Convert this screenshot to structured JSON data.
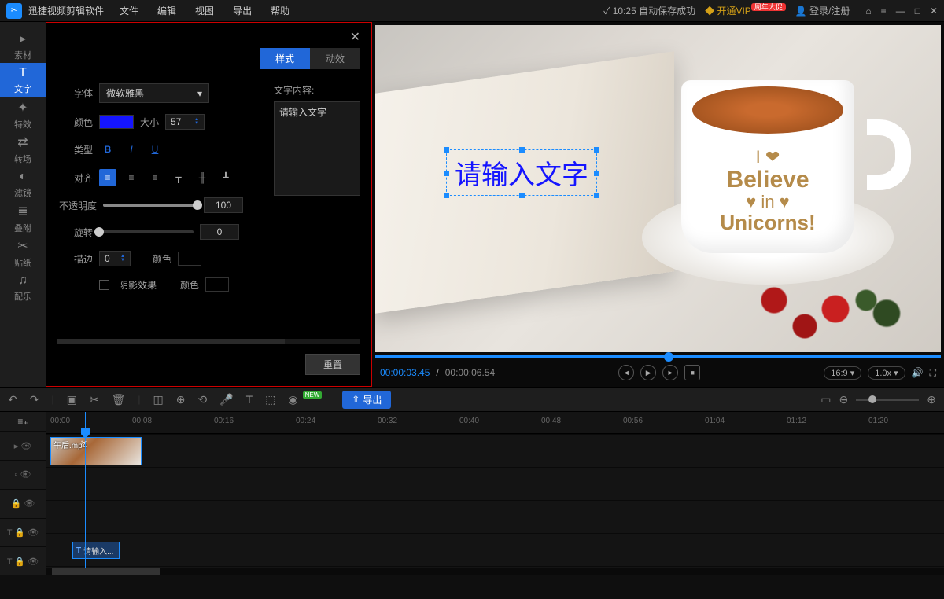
{
  "app": {
    "name": "迅捷视频剪辑软件"
  },
  "menu": {
    "file": "文件",
    "edit": "编辑",
    "view": "视图",
    "export": "导出",
    "help": "帮助"
  },
  "topright": {
    "autosave": "10:25 自动保存成功",
    "vip": "开通VIP",
    "vipbadge": "周年大促",
    "login": "登录/注册"
  },
  "sidebar": {
    "items": [
      {
        "icon": "▸",
        "label": "素材"
      },
      {
        "icon": "T",
        "label": "文字"
      },
      {
        "icon": "✦",
        "label": "特效"
      },
      {
        "icon": "⇄",
        "label": "转场"
      },
      {
        "icon": "◐",
        "label": "滤镜"
      },
      {
        "icon": "≣",
        "label": "叠附"
      },
      {
        "icon": "✂",
        "label": "贴纸"
      },
      {
        "icon": "♫",
        "label": "配乐"
      }
    ]
  },
  "panel": {
    "tabs": {
      "style": "样式",
      "motion": "动效"
    },
    "font": {
      "label": "字体",
      "value": "微软雅黑"
    },
    "color": {
      "label": "颜色",
      "value": "#1515ff"
    },
    "size": {
      "label": "大小",
      "value": "57"
    },
    "type": {
      "label": "类型"
    },
    "align": {
      "label": "对齐"
    },
    "opacity": {
      "label": "不透明度",
      "value": "100",
      "pct": 100
    },
    "rotate": {
      "label": "旋转",
      "value": "0",
      "pct": 0
    },
    "stroke": {
      "label": "描边",
      "value": "0",
      "colorlabel": "颜色",
      "color": "#000000"
    },
    "shadow": {
      "label": "阴影效果",
      "colorlabel": "颜色",
      "color": "#000000"
    },
    "textcontent": {
      "label": "文字内容:",
      "value": "请输入文字"
    },
    "reset": "重置"
  },
  "preview": {
    "overlay": "请输入文字",
    "mugline1": "I ❤",
    "mugline2": "Believe",
    "mugline3": "♥ in ♥",
    "mugline4": "Unicorns!",
    "time_cur": "00:00:03.45",
    "time_tot": "00:00:06.54",
    "ratio": "16:9",
    "speed": "1.0x"
  },
  "toolbar": {
    "export": "导出",
    "new": "NEW"
  },
  "timeline": {
    "ticks": [
      "00:00",
      "00:08",
      "00:16",
      "00:24",
      "00:32",
      "00:40",
      "00:48",
      "00:56",
      "01:04",
      "01:12",
      "01:20"
    ],
    "clip_name": "午后.mp4",
    "text_clip": "请输入..."
  }
}
